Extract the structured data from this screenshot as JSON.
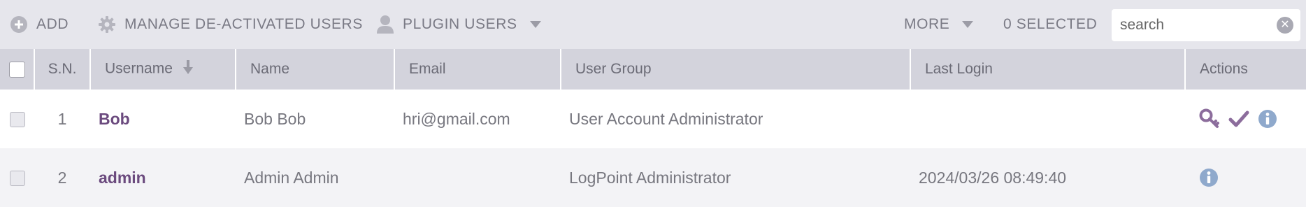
{
  "toolbar": {
    "add_label": "ADD",
    "manage_label": "MANAGE DE-ACTIVATED USERS",
    "plugin_label": "PLUGIN USERS",
    "more_label": "MORE",
    "selected_label": "0 SELECTED",
    "search_placeholder": "search"
  },
  "table": {
    "headers": {
      "sn": "S.N.",
      "username": "Username",
      "name": "Name",
      "email": "Email",
      "user_group": "User Group",
      "last_login": "Last Login",
      "actions": "Actions"
    },
    "rows": [
      {
        "sn": "1",
        "username": "Bob",
        "name": "Bob Bob",
        "email": "hri@gmail.com",
        "user_group": "User Account Administrator",
        "last_login": "",
        "actions": [
          "key-icon",
          "check-icon",
          "info-icon"
        ]
      },
      {
        "sn": "2",
        "username": "admin",
        "name": "Admin Admin",
        "email": "",
        "user_group": "LogPoint Administrator",
        "last_login": "2024/03/26 08:49:40",
        "actions": [
          "info-icon"
        ]
      }
    ]
  },
  "colors": {
    "toolbar_bg": "#e6e6ec",
    "header_bg": "#d3d3dc",
    "username_color": "#6b4a7e",
    "key_icon": "#8c6d9c",
    "check_icon": "#8c6d9c",
    "info_icon": "#8fa9cc"
  }
}
